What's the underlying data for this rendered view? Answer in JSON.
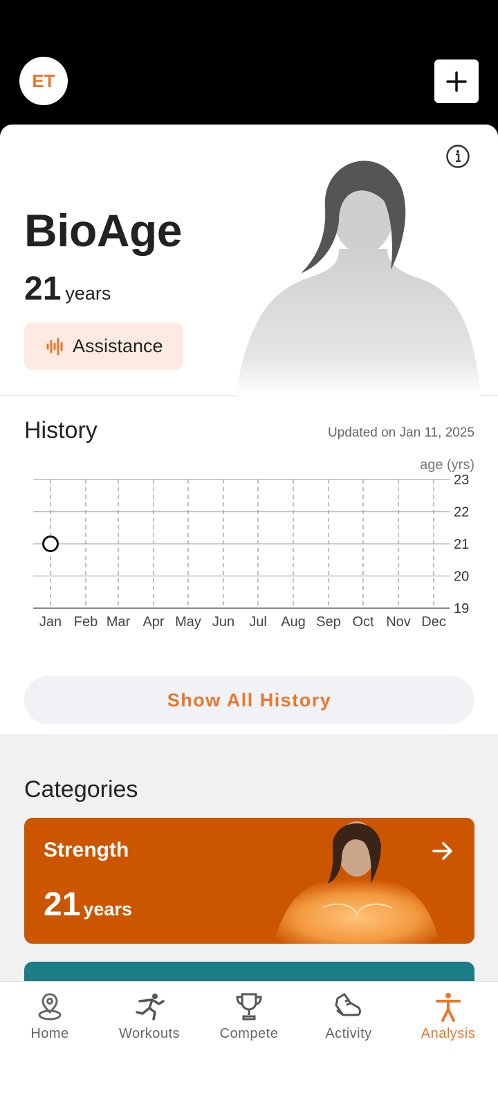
{
  "header": {
    "avatar_initials": "ET"
  },
  "bioage": {
    "title": "BioAge",
    "age_value": "21",
    "age_unit": "years",
    "assistance_label": "Assistance"
  },
  "history": {
    "title": "History",
    "updated": "Updated on Jan 11, 2025",
    "unit_label": "age (yrs)",
    "show_all_label": "Show All History"
  },
  "chart_data": {
    "type": "scatter",
    "x": [
      "Jan",
      "Feb",
      "Mar",
      "Apr",
      "May",
      "Jun",
      "Jul",
      "Aug",
      "Sep",
      "Oct",
      "Nov",
      "Dec"
    ],
    "y_ticks": [
      23,
      22,
      21,
      20,
      19
    ],
    "ylim": [
      19,
      23
    ],
    "ylabel": "age (yrs)",
    "points": [
      {
        "x": "Jan",
        "y": 21
      }
    ],
    "grid": true
  },
  "categories": {
    "title": "Categories",
    "items": [
      {
        "name": "Strength",
        "age_value": "21",
        "age_unit": "years",
        "color": "#cc5500"
      },
      {
        "color": "#1b7d86"
      }
    ]
  },
  "tabs": [
    {
      "label": "Home",
      "icon": "home-pin-icon",
      "active": false
    },
    {
      "label": "Workouts",
      "icon": "runner-icon",
      "active": false
    },
    {
      "label": "Compete",
      "icon": "trophy-icon",
      "active": false
    },
    {
      "label": "Activity",
      "icon": "shoe-icon",
      "active": false
    },
    {
      "label": "Analysis",
      "icon": "body-icon",
      "active": true
    }
  ],
  "colors": {
    "accent": "#e8772e",
    "strength_card": "#cc5500",
    "teal_card": "#1b7d86"
  }
}
